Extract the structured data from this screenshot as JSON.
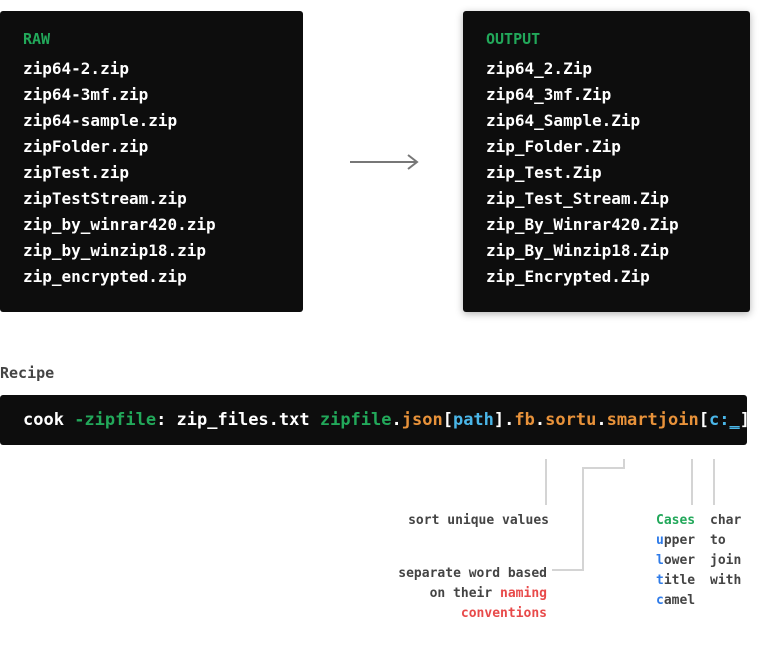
{
  "raw": {
    "title": "RAW",
    "items": [
      "zip64-2.zip",
      "zip64-3mf.zip",
      "zip64-sample.zip",
      "zipFolder.zip",
      "zipTest.zip",
      "zipTestStream.zip",
      "zip_by_winrar420.zip",
      "zip_by_winzip18.zip",
      "zip_encrypted.zip"
    ]
  },
  "output": {
    "title": "OUTPUT",
    "items": [
      "zip64_2.Zip",
      "zip64_3mf.Zip",
      "zip64_Sample.Zip",
      "zip_Folder.Zip",
      "zip_Test.Zip",
      "zip_Test_Stream.Zip",
      "zip_By_Winrar420.Zip",
      "zip_By_Winzip18.Zip",
      "zip_Encrypted.Zip"
    ]
  },
  "recipe": {
    "label": "Recipe",
    "parts": {
      "cmd": "cook ",
      "flag": "-zipfile",
      "colon": ": zip_files.txt ",
      "src": "zipfile",
      "dot1": ".",
      "json": "json",
      "lb1": "[",
      "path": "path",
      "rb1": "]",
      "dot2": ".",
      "fb": "fb",
      "dot3": ".",
      "sortu": "sortu",
      "dot4": ".",
      "smartjoin": "smartjoin",
      "lb2": "[",
      "c": "c:",
      "us": "_",
      "rb2": "]"
    }
  },
  "annotations": {
    "sortu": "sort unique values",
    "fb_line1": "separate word based",
    "fb_line2a": "on their ",
    "fb_line2b": "naming",
    "fb_line3": "conventions",
    "cases_title": "Cases",
    "cases": [
      {
        "first": "u",
        "rest": "pper"
      },
      {
        "first": "l",
        "rest": "ower"
      },
      {
        "first": "t",
        "rest": "itle"
      },
      {
        "first": "c",
        "rest": "amel"
      }
    ],
    "join": [
      "char",
      "to",
      "join",
      "with"
    ]
  },
  "colors": {
    "green": "#22a85a",
    "orange": "#e8923a",
    "cyan": "#4ab6e8",
    "red": "#e84a4a",
    "blue": "#2f7be8"
  }
}
